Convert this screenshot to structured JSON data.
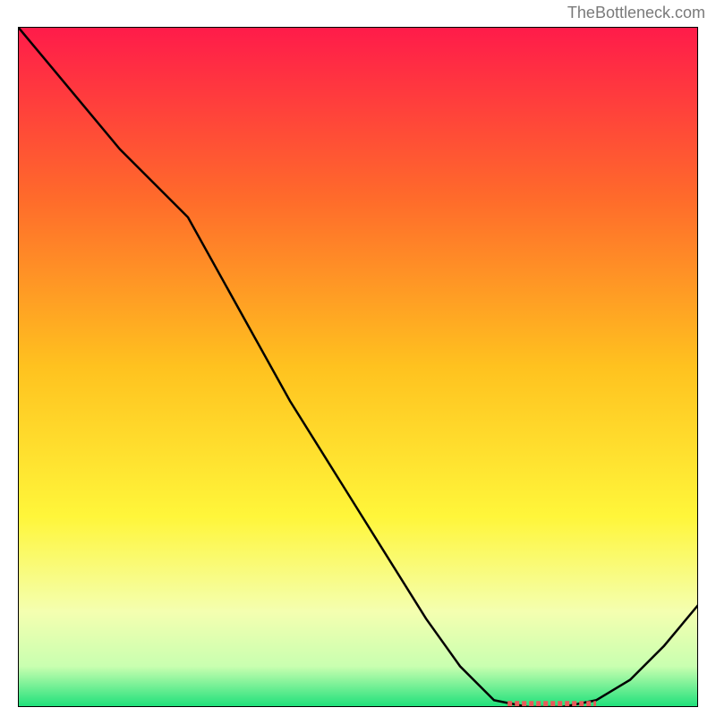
{
  "watermark": "TheBottleneck.com",
  "chart_data": {
    "type": "line",
    "title": "",
    "xlabel": "",
    "ylabel": "",
    "xlim": [
      0,
      100
    ],
    "ylim": [
      0,
      100
    ],
    "x": [
      0,
      5,
      10,
      15,
      20,
      25,
      30,
      35,
      40,
      45,
      50,
      55,
      60,
      65,
      70,
      75,
      80,
      85,
      90,
      95,
      100
    ],
    "values": [
      100,
      94,
      88,
      82,
      77,
      72,
      63,
      54,
      45,
      37,
      29,
      21,
      13,
      6,
      1,
      0,
      0,
      1,
      4,
      9,
      15
    ],
    "marker_band": {
      "x_start": 72,
      "x_end": 85,
      "y": 0.5
    },
    "background_gradient": {
      "stops": [
        {
          "pos": 0.0,
          "color": "#ff1b4a"
        },
        {
          "pos": 0.25,
          "color": "#ff6a2b"
        },
        {
          "pos": 0.5,
          "color": "#ffc21f"
        },
        {
          "pos": 0.72,
          "color": "#fff63a"
        },
        {
          "pos": 0.86,
          "color": "#f4ffb0"
        },
        {
          "pos": 0.94,
          "color": "#c9ffb0"
        },
        {
          "pos": 1.0,
          "color": "#1de07a"
        }
      ]
    },
    "line_color": "#000000",
    "marker_color": "#e85a5a"
  }
}
